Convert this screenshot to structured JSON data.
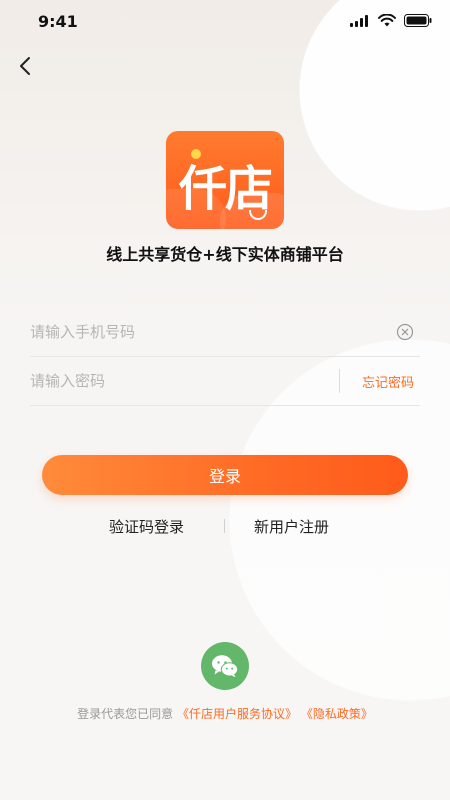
{
  "status_bar": {
    "time": "9:41"
  },
  "brand": {
    "logo_text": "仟店"
  },
  "slogan": "线上共享货仓+线下实体商铺平台",
  "form": {
    "phone": {
      "placeholder": "请输入手机号码",
      "value": ""
    },
    "password": {
      "placeholder": "请输入密码",
      "value": ""
    },
    "forgot_label": "忘记密码",
    "login_label": "登录"
  },
  "alt": {
    "sms_login_label": "验证码登录",
    "register_label": "新用户注册"
  },
  "agreement": {
    "prefix": "登录代表您已同意",
    "terms": "《仟店用户服务协议》",
    "privacy": "《隐私政策》"
  },
  "colors": {
    "accent": "#ff6a22",
    "wechat_green": "#62b76b"
  },
  "icons": {
    "back": "chevron-left-icon",
    "clear": "clear-circle-icon",
    "wechat": "wechat-icon",
    "signal": "signal-icon",
    "wifi": "wifi-icon",
    "battery": "battery-icon"
  }
}
